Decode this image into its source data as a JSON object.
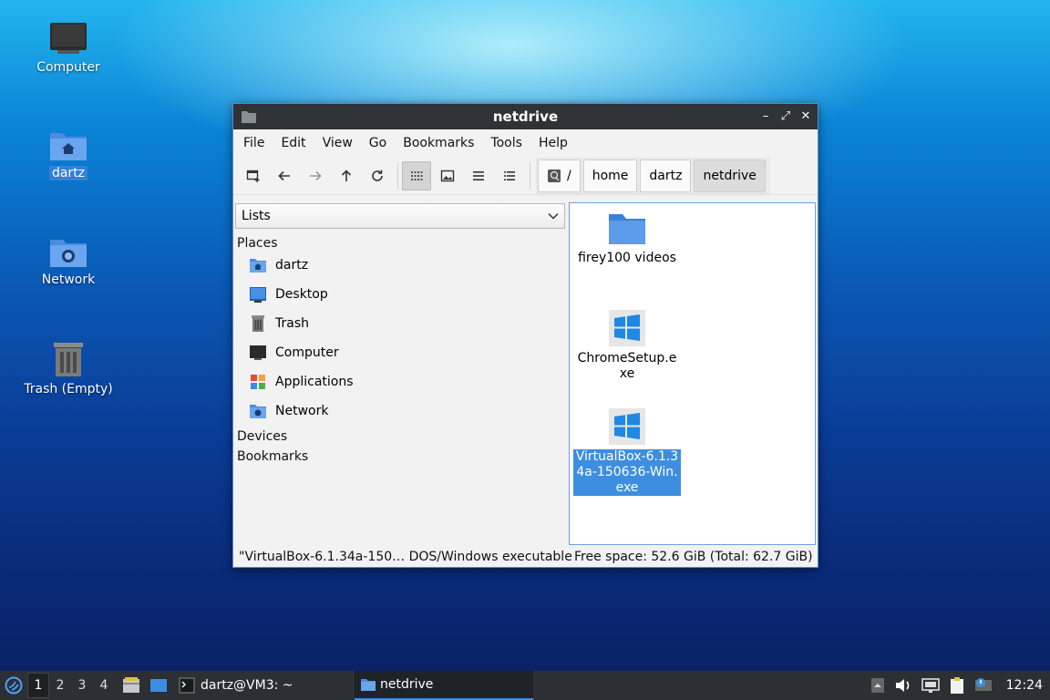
{
  "desktop": {
    "icons": [
      {
        "label": "Computer"
      },
      {
        "label": "dartz"
      },
      {
        "label": "Network"
      },
      {
        "label": "Trash (Empty)"
      }
    ]
  },
  "window": {
    "title": "netdrive",
    "menu": [
      "File",
      "Edit",
      "View",
      "Go",
      "Bookmarks",
      "Tools",
      "Help"
    ],
    "path": {
      "root": "/",
      "crumbs": [
        "home",
        "dartz",
        "netdrive"
      ]
    },
    "side": {
      "combo": "Lists",
      "places_label": "Places",
      "places": [
        "dartz",
        "Desktop",
        "Trash",
        "Computer",
        "Applications",
        "Network"
      ],
      "devices_label": "Devices",
      "bookmarks_label": "Bookmarks"
    },
    "files": [
      {
        "name": "firey100 videos",
        "icon": "folder-icon"
      },
      {
        "name": "ChromeSetup.exe",
        "icon": "windows-exe-icon"
      },
      {
        "name": "VirtualBox-6.1.34a-150636-Win.exe",
        "icon": "windows-exe-icon"
      }
    ],
    "status": {
      "selection": "\"VirtualBox-6.1.34a-150… DOS/Windows executable",
      "free": "Free space: 52.6 GiB (Total: 62.7 GiB)"
    }
  },
  "taskbar": {
    "workspaces": [
      "1",
      "2",
      "3",
      "4"
    ],
    "terminal_task": "dartz@VM3: ~",
    "window_task": "netdrive",
    "clock": "12:24"
  },
  "colors": {
    "accent": "#3d8ee0",
    "titlebar": "#2f3337",
    "taskbar": "#2c2f33"
  }
}
